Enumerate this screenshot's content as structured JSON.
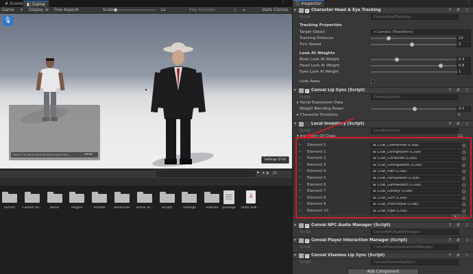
{
  "scene_panel": {
    "tabs": [
      "Scene",
      "Game"
    ],
    "toolbar": {
      "mode": "Game",
      "display": "Display 1",
      "aspect": "Free Aspect",
      "scale_label": "Scale",
      "scale_value": "1x",
      "play_focused": "Play Focused",
      "stats": "Stats",
      "gizmos": "Gizmos"
    },
    "chat_logo": "convai",
    "chat_input_hint": "Hold [T] to talk or press [Enter] to type here...",
    "settings_button": "Settings [F10]"
  },
  "project_panel": {
    "item_count": "26",
    "folders": [
      "racters",
      "Custom Pa...",
      "Demo",
      "Plugins",
      "Prefabs",
      "Resources",
      "Scene Te...",
      "Scripts",
      "Settings",
      "Tutorials"
    ],
    "files": [
      {
        "name": "package",
        "kind": "doc"
      },
      {
        "name": "Unity SDK ...",
        "kind": "pdf"
      }
    ]
  },
  "inspector": {
    "tab": "Inspector",
    "head_eye": {
      "title": "Character Head & Eye Tracking",
      "script_label": "Script",
      "script_value": "ConvaiHeadTracking",
      "tracking_properties": "Tracking Properties",
      "target_object_label": "Target Object",
      "target_object_value": "Camera (Transform)",
      "tracking_distance_label": "Tracking Distance",
      "tracking_distance_value": "10",
      "turn_speed_label": "Turn Speed",
      "turn_speed_value": "5",
      "look_at_weights": "Look At Weights",
      "body_look_label": "Body Look At Weight",
      "body_look_value": "0.3",
      "head_look_label": "Head Look At Weight",
      "head_look_value": "0.8",
      "eyes_look_label": "Eyes Look At Weight",
      "eyes_look_value": "1",
      "look_away_label": "Look Away"
    },
    "lip_sync": {
      "title": "Convai Lip Sync (Script)",
      "script_label": "Script",
      "script_value": "ConvaiLipSync",
      "facial_data_label": "Facial Expression Data",
      "weight_blending_label": "Weight Blending Power",
      "weight_blending_value": "0.5",
      "character_emotions_label": "Character Emotions",
      "character_emotions_value": "0"
    },
    "local_inventory": {
      "title": "Local Inventory (Script)",
      "script_label": "Script",
      "script_value": "LocalInventory",
      "inventory_label": "Inventory Of Clues",
      "inventory_count": "11",
      "elements": [
        {
          "name": "Element 0",
          "value": "Clue_ChefWhite (Clue)"
        },
        {
          "name": "Element 1",
          "value": "Clue_LivingRoom (Clue)"
        },
        {
          "name": "Element 2",
          "value": "Clue_ColYellow (Clue)"
        },
        {
          "name": "Element 3",
          "value": "Clue_DiningRoom (Clue)"
        },
        {
          "name": "Element 4",
          "value": "Clue_Hall (Clue)"
        },
        {
          "name": "Element 5",
          "value": "Clue_PartyRoom (Clue)"
        },
        {
          "name": "Element 6",
          "value": "Clue_GameRoom (Clue)"
        },
        {
          "name": "Element 7",
          "value": "Clue_Library (Clue)"
        },
        {
          "name": "Element 8",
          "value": "Clue_Gun (Clue)"
        },
        {
          "name": "Element 9",
          "value": "Clue_ProfPurple (Clue)"
        },
        {
          "name": "Element 10",
          "value": "Clue_Pipe (Clue)"
        }
      ],
      "add_button": "+",
      "remove_button": "-"
    },
    "npc_audio": {
      "title": "Convai NPC Audio Manager (Script)",
      "script_label": "Script",
      "script_value": "ConvaiNPCAudioManager"
    },
    "player_interaction": {
      "title": "Convai Player Interaction Manager (Script)",
      "script_label": "Script",
      "script_value": "ConvaiPlayerInteractionManager"
    },
    "visemes": {
      "title": "Convai Visemes Lip Sync (Script)",
      "script_label": "Script",
      "script_value": "ConvaiVisemesLipSync"
    },
    "add_component": "Add Component"
  },
  "colors": {
    "annotation_red": "#d81b25",
    "accent_blue": "#2c7ad6"
  }
}
